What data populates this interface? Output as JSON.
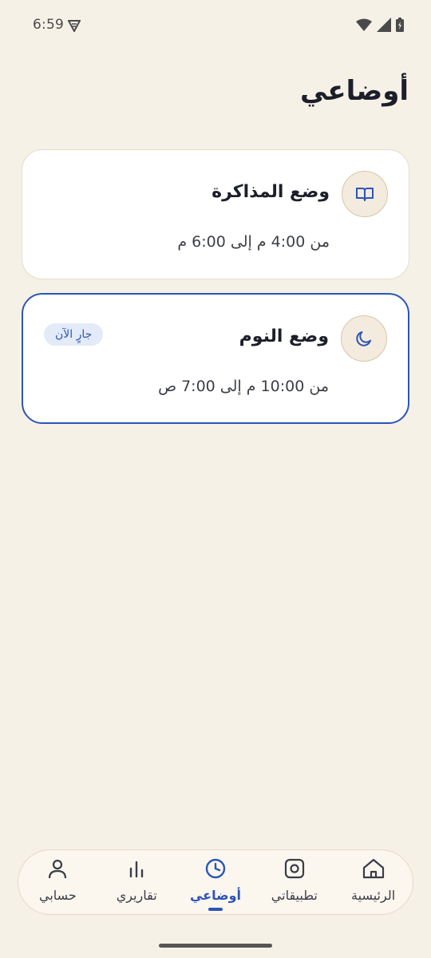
{
  "status_bar": {
    "time": "6:59"
  },
  "header": {
    "title": "أوضاعي"
  },
  "modes": [
    {
      "title": "وضع المذاكرة",
      "time": "من 4:00 م إلى 6:00 م",
      "icon": "book-icon",
      "active": false
    },
    {
      "title": "وضع النوم",
      "time": "من 10:00 م إلى 7:00 ص",
      "icon": "moon-icon",
      "active": true,
      "badge": "جارٍ الآن"
    }
  ],
  "nav": {
    "items": [
      {
        "label": "حسابي",
        "icon": "person-icon"
      },
      {
        "label": "تقاريري",
        "icon": "bar-chart-icon"
      },
      {
        "label": "أوضاعي",
        "icon": "clock-icon",
        "active": true
      },
      {
        "label": "تطبيقاتي",
        "icon": "apps-icon"
      },
      {
        "label": "الرئيسية",
        "icon": "home-icon"
      }
    ]
  },
  "colors": {
    "background": "#f6f1e7",
    "accent": "#2c55b8",
    "card": "#ffffff"
  }
}
